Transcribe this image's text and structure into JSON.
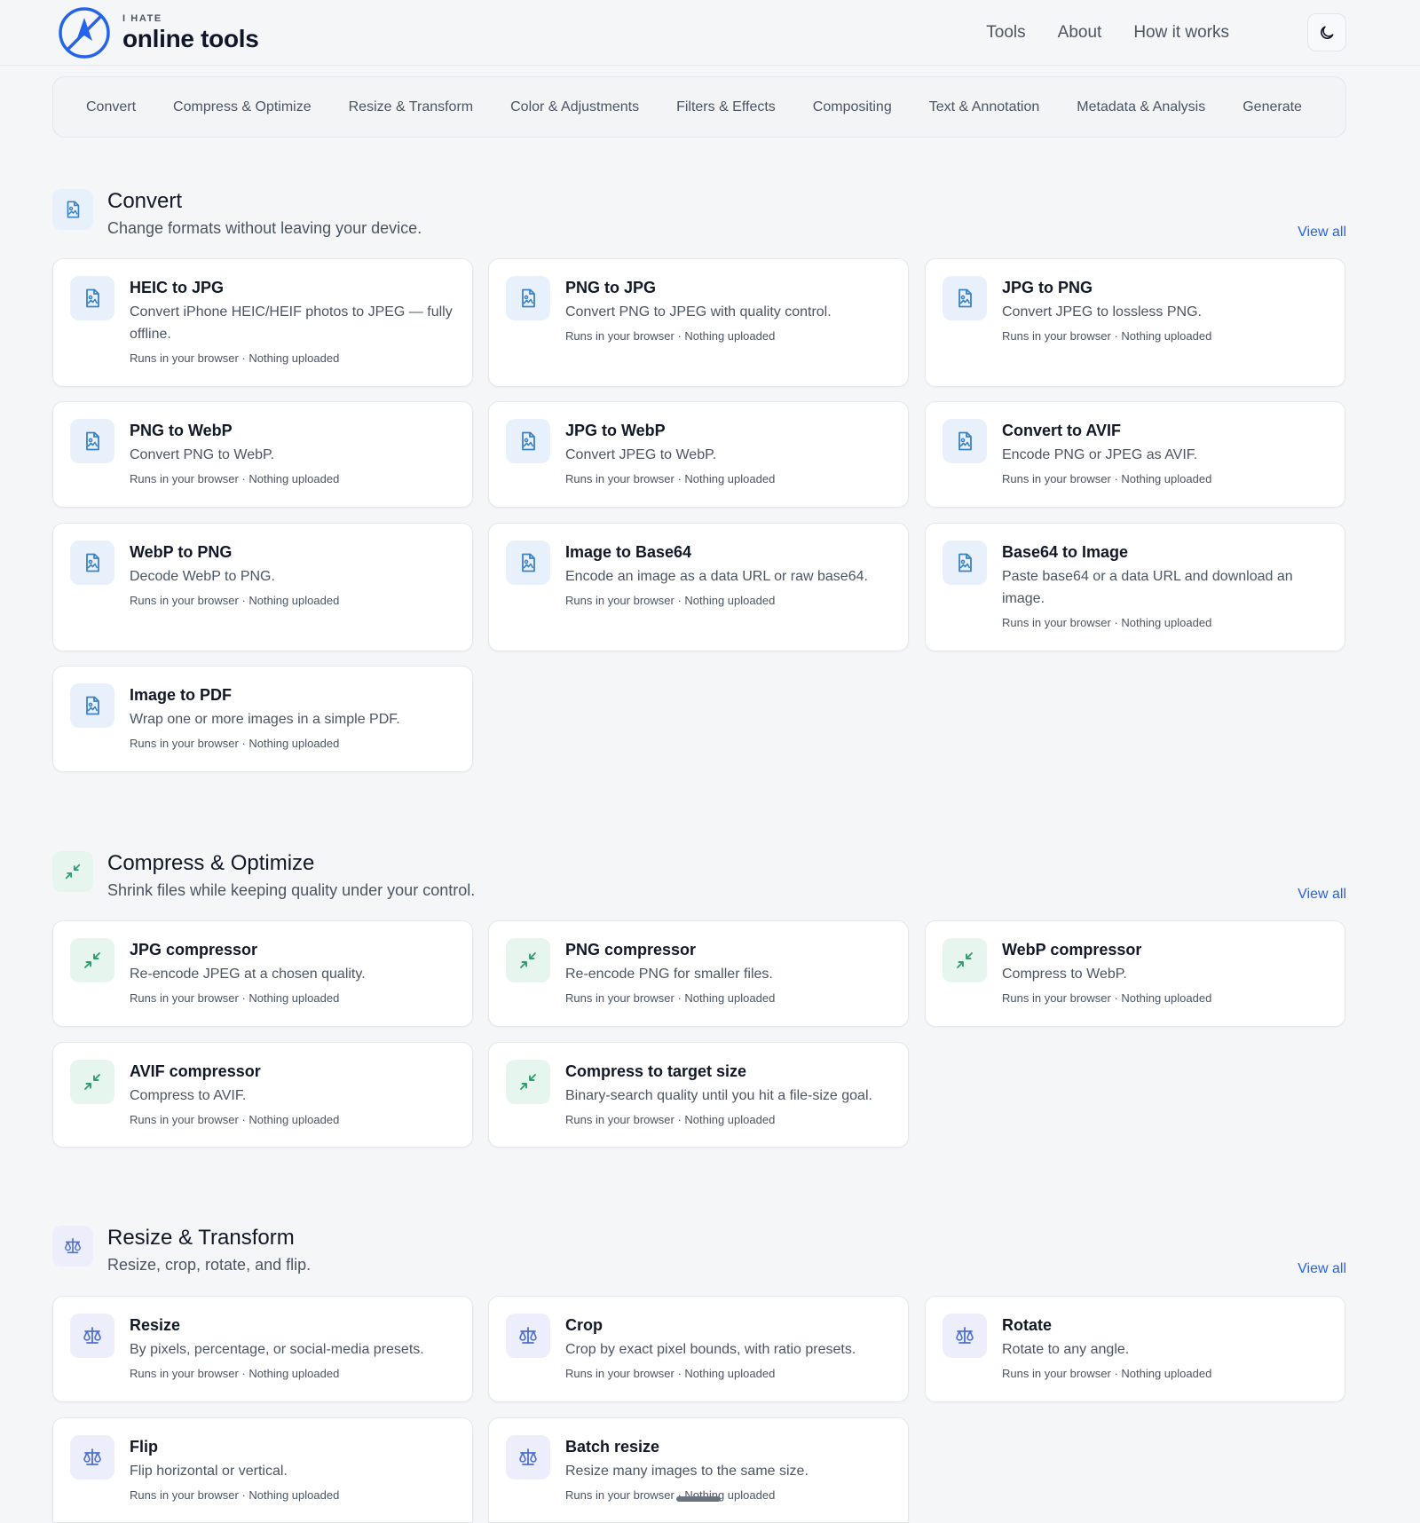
{
  "brand": {
    "small": "I HATE",
    "name": "online tools"
  },
  "nav": [
    "Tools",
    "About",
    "How it works"
  ],
  "categories": [
    "Convert",
    "Compress & Optimize",
    "Resize & Transform",
    "Color & Adjustments",
    "Filters & Effects",
    "Compositing",
    "Text & Annotation",
    "Metadata & Analysis",
    "Generate"
  ],
  "colors": {
    "accent": "#2563eb",
    "convert_icon": "#3b82c4",
    "compress_icon": "#2f9e6e",
    "resize_icon": "#4f6fd0"
  },
  "sections": [
    {
      "icon": "file-image-icon",
      "title": "Convert",
      "subtitle": "Change formats without leaving your device.",
      "view_all": "View all",
      "tools": [
        {
          "title": "HEIC to JPG",
          "desc": "Convert iPhone HEIC/HEIF photos to JPEG — fully offline.",
          "meta": "Runs in your browser · Nothing uploaded"
        },
        {
          "title": "PNG to JPG",
          "desc": "Convert PNG to JPEG with quality control.",
          "meta": "Runs in your browser · Nothing uploaded"
        },
        {
          "title": "JPG to PNG",
          "desc": "Convert JPEG to lossless PNG.",
          "meta": "Runs in your browser · Nothing uploaded"
        },
        {
          "title": "PNG to WebP",
          "desc": "Convert PNG to WebP.",
          "meta": "Runs in your browser · Nothing uploaded"
        },
        {
          "title": "JPG to WebP",
          "desc": "Convert JPEG to WebP.",
          "meta": "Runs in your browser · Nothing uploaded"
        },
        {
          "title": "Convert to AVIF",
          "desc": "Encode PNG or JPEG as AVIF.",
          "meta": "Runs in your browser · Nothing uploaded"
        },
        {
          "title": "WebP to PNG",
          "desc": "Decode WebP to PNG.",
          "meta": "Runs in your browser · Nothing uploaded"
        },
        {
          "title": "Image to Base64",
          "desc": "Encode an image as a data URL or raw base64.",
          "meta": "Runs in your browser · Nothing uploaded"
        },
        {
          "title": "Base64 to Image",
          "desc": "Paste base64 or a data URL and download an image.",
          "meta": "Runs in your browser · Nothing uploaded"
        },
        {
          "title": "Image to PDF",
          "desc": "Wrap one or more images in a simple PDF.",
          "meta": "Runs in your browser · Nothing uploaded"
        }
      ]
    },
    {
      "icon": "compress-arrows-icon",
      "title": "Compress & Optimize",
      "subtitle": "Shrink files while keeping quality under your control.",
      "view_all": "View all",
      "tools": [
        {
          "title": "JPG compressor",
          "desc": "Re-encode JPEG at a chosen quality.",
          "meta": "Runs in your browser · Nothing uploaded"
        },
        {
          "title": "PNG compressor",
          "desc": "Re-encode PNG for smaller files.",
          "meta": "Runs in your browser · Nothing uploaded"
        },
        {
          "title": "WebP compressor",
          "desc": "Compress to WebP.",
          "meta": "Runs in your browser · Nothing uploaded"
        },
        {
          "title": "AVIF compressor",
          "desc": "Compress to AVIF.",
          "meta": "Runs in your browser · Nothing uploaded"
        },
        {
          "title": "Compress to target size",
          "desc": "Binary-search quality until you hit a file-size goal.",
          "meta": "Runs in your browser · Nothing uploaded"
        }
      ]
    },
    {
      "icon": "scale-icon",
      "title": "Resize & Transform",
      "subtitle": "Resize, crop, rotate, and flip.",
      "view_all": "View all",
      "tools": [
        {
          "title": "Resize",
          "desc": "By pixels, percentage, or social-media presets.",
          "meta": "Runs in your browser · Nothing uploaded"
        },
        {
          "title": "Crop",
          "desc": "Crop by exact pixel bounds, with ratio presets.",
          "meta": "Runs in your browser · Nothing uploaded"
        },
        {
          "title": "Rotate",
          "desc": "Rotate to any angle.",
          "meta": "Runs in your browser · Nothing uploaded"
        },
        {
          "title": "Flip",
          "desc": "Flip horizontal or vertical.",
          "meta": "Runs in your browser · Nothing uploaded"
        },
        {
          "title": "Batch resize",
          "desc": "Resize many images to the same size.",
          "meta": "Runs in your browser · Nothing uploaded"
        }
      ]
    }
  ]
}
